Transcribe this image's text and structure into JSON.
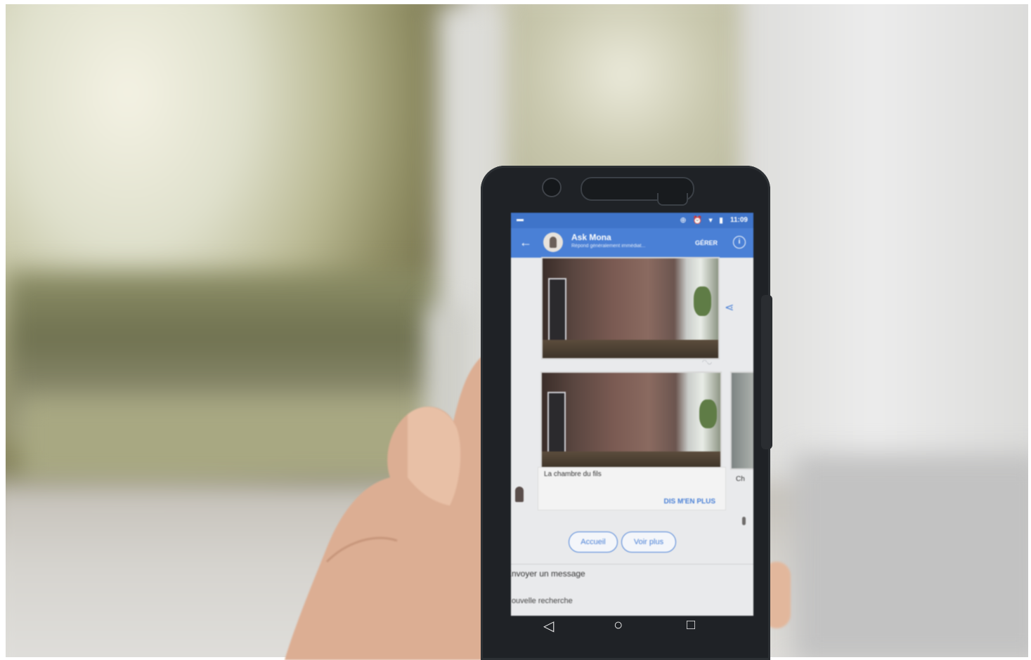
{
  "photo": {
    "subject": "hand holding smartphone showing messenger chat"
  },
  "status_bar": {
    "time": "11:09",
    "icons": "⊕ ⏰ ▾ ▮"
  },
  "app_bar": {
    "back_icon": "arrow-left-icon",
    "title": "Ask Mona",
    "subtitle": "Répond généralement immédiat...",
    "manage_label": "GÉRER",
    "info_icon": "info-icon"
  },
  "chat": {
    "card_caption": "La chambre du fils",
    "card_action": "DIS M'EN PLUS",
    "next_card_caption": "Ch"
  },
  "quick_replies": [
    {
      "label": "Accueil"
    },
    {
      "label": "Voir plus"
    }
  ],
  "composer": {
    "placeholder": "Envoyer un message",
    "suggestion": "Nouvelle recherche"
  },
  "nav": {
    "back": "◁",
    "home": "○",
    "recents": "□"
  },
  "colors": {
    "accent": "#4a80d6",
    "statusbar": "#3f74c9"
  }
}
